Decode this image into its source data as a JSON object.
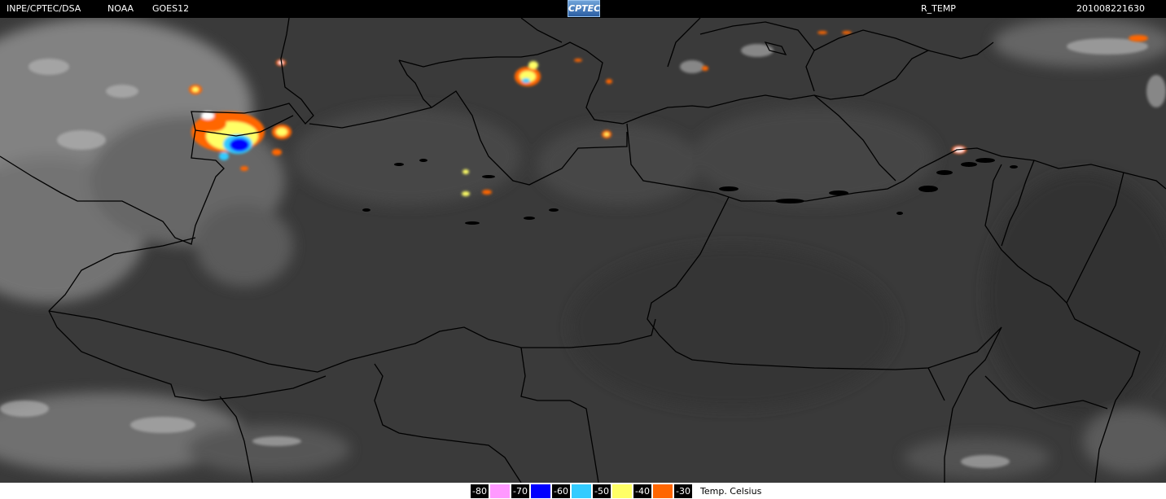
{
  "header": {
    "source": "INPE/CPTEC/DSA",
    "agency": "NOAA",
    "satellite": "GOES12",
    "logo_text": "CPTEC",
    "product": "R_TEMP",
    "timestamp": "201008221630"
  },
  "legend": {
    "items": [
      {
        "label": "-80",
        "color": "#ff99ff"
      },
      {
        "label": "-70",
        "color": "#0000ff"
      },
      {
        "label": "-60",
        "color": "#33ccff"
      },
      {
        "label": "-50",
        "color": "#ffff66"
      },
      {
        "label": "-40",
        "color": "#ff6600"
      },
      {
        "label": "-30",
        "color": ""
      }
    ],
    "unit": "Temp. Celsius"
  }
}
